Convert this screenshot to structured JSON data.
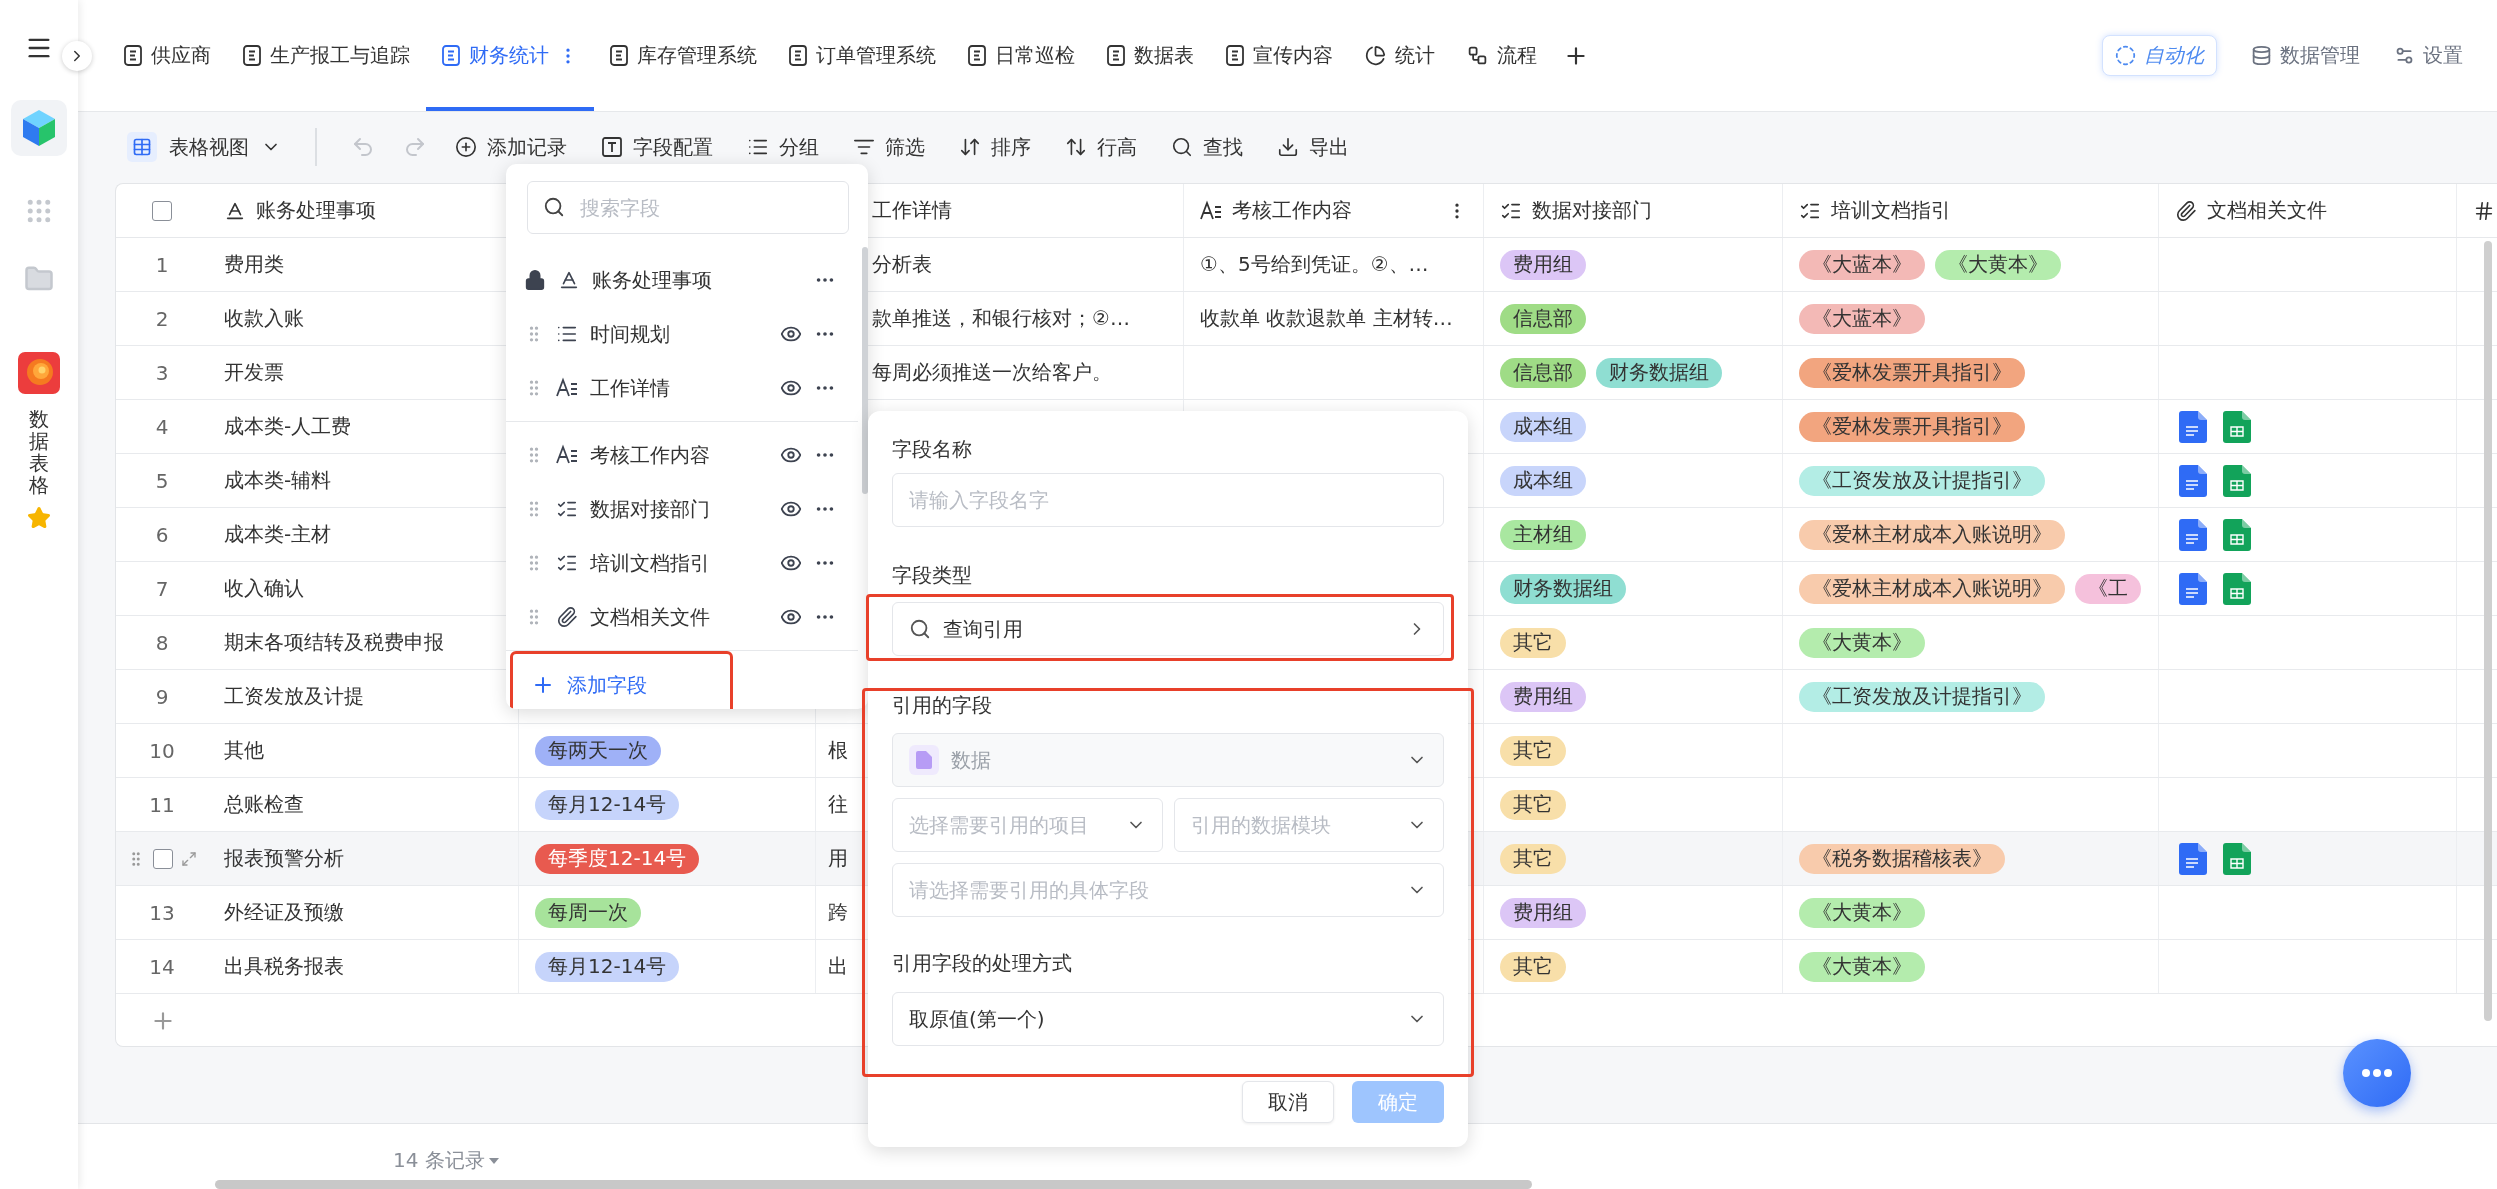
{
  "sidebar": {
    "app_name": "数据表格",
    "favorite": true
  },
  "tabs": [
    {
      "label": "供应商",
      "kind": "doc",
      "selected": false
    },
    {
      "label": "生产报工与追踪",
      "kind": "doc",
      "selected": false
    },
    {
      "label": "财务统计",
      "kind": "doc",
      "selected": true
    },
    {
      "label": "库存管理系统",
      "kind": "doc",
      "selected": false
    },
    {
      "label": "订单管理系统",
      "kind": "doc",
      "selected": false
    },
    {
      "label": "日常巡检",
      "kind": "doc",
      "selected": false
    },
    {
      "label": "数据表",
      "kind": "doc",
      "selected": false
    },
    {
      "label": "宣传内容",
      "kind": "doc",
      "selected": false
    },
    {
      "label": "统计",
      "kind": "chart",
      "selected": false
    },
    {
      "label": "流程",
      "kind": "flow",
      "selected": false
    }
  ],
  "top_actions": [
    {
      "label": "自动化",
      "kind": "automation"
    },
    {
      "label": "数据管理",
      "kind": "data"
    },
    {
      "label": "设置",
      "kind": "settings"
    }
  ],
  "toolbar": {
    "view": "表格视图",
    "history": [
      {
        "kind": "undo",
        "disabled": true
      },
      {
        "kind": "redo",
        "disabled": true
      }
    ],
    "actions": [
      {
        "label": "添加记录",
        "kind": "add"
      },
      {
        "label": "字段配置",
        "kind": "fields"
      },
      {
        "label": "分组",
        "kind": "group"
      },
      {
        "label": "筛选",
        "kind": "filter"
      },
      {
        "label": "排序",
        "kind": "sort"
      },
      {
        "label": "行高",
        "kind": "row_height"
      },
      {
        "label": "查找",
        "kind": "find"
      },
      {
        "label": "导出",
        "kind": "export"
      }
    ]
  },
  "table": {
    "all_checked": false,
    "columns": [
      {
        "label": "账务处理事项",
        "kind": "text"
      },
      {
        "label": "工作详情"
      },
      {
        "label": "考核工作内容",
        "kind": "long_text",
        "menu": true
      },
      {
        "label": "数据对接部门",
        "kind": "multi_select"
      },
      {
        "label": "培训文档指引",
        "kind": "multi_select"
      },
      {
        "label": "文档相关文件",
        "kind": "attachment"
      },
      {
        "kind": "number"
      }
    ],
    "rows": [
      {
        "number": "1",
        "item": "费用类",
        "detail": "分析表",
        "review": "①、5号给到凭证。②、…",
        "departments": [
          {
            "label": "费用组",
            "color": "#dcc6f6"
          }
        ],
        "guides": [
          {
            "label": "《大蓝本》",
            "color": "#f3b9b6"
          },
          {
            "label": "《大黄本》",
            "color": "#b4ecad"
          }
        ],
        "hovered": false,
        "checked": false
      },
      {
        "number": "2",
        "item": "收款入账",
        "detail": "款单推送，和银行核对；②…",
        "review": "收款单 收款退款单 主材转…",
        "departments": [
          {
            "label": "信息部",
            "color": "#9fdc86"
          }
        ],
        "guides": [
          {
            "label": "《大蓝本》",
            "color": "#f3b9b6"
          }
        ],
        "hovered": false,
        "checked": false
      },
      {
        "number": "3",
        "item": "开发票",
        "detail": "每周必须推送一次给客户。",
        "departments": [
          {
            "label": "信息部",
            "color": "#9fdc86"
          },
          {
            "label": "财务数据组",
            "color": "#8fded2"
          }
        ],
        "guides": [
          {
            "label": "《爱林发票开具指引》",
            "color": "#f2a57f"
          }
        ],
        "hovered": false,
        "checked": false
      },
      {
        "number": "4",
        "item": "成本类-人工费",
        "departments": [
          {
            "label": "成本组",
            "color": "#c8d5fb"
          }
        ],
        "guides": [
          {
            "label": "《爱林发票开具指引》",
            "color": "#f2a57f"
          }
        ],
        "files": [
          {
            "kind": "doc"
          },
          {
            "kind": "sheet"
          }
        ],
        "hovered": false,
        "checked": false
      },
      {
        "number": "5",
        "item": "成本类-辅料",
        "departments": [
          {
            "label": "成本组",
            "color": "#c8d5fb"
          }
        ],
        "guides": [
          {
            "label": "《工资发放及计提指引》",
            "color": "#b3ede5"
          }
        ],
        "files": [
          {
            "kind": "doc"
          },
          {
            "kind": "sheet"
          }
        ],
        "hovered": false,
        "checked": false
      },
      {
        "number": "6",
        "item": "成本类-主材",
        "departments": [
          {
            "label": "主材组",
            "color": "#a9e7a0"
          }
        ],
        "guides": [
          {
            "label": "《爱林主材成本入账说明》",
            "color": "#f8cbac"
          }
        ],
        "files": [
          {
            "kind": "doc"
          },
          {
            "kind": "sheet"
          }
        ],
        "hovered": false,
        "checked": false
      },
      {
        "number": "7",
        "item": "收入确认",
        "departments": [
          {
            "label": "财务数据组",
            "color": "#8fded2"
          }
        ],
        "guides": [
          {
            "label": "《爱林主材成本入账说明》",
            "color": "#f8cbac"
          },
          {
            "label": "《工",
            "color": "#f5c1dc"
          }
        ],
        "files": [
          {
            "kind": "doc"
          },
          {
            "kind": "sheet"
          }
        ],
        "hovered": false,
        "checked": false
      },
      {
        "number": "8",
        "item": "期末各项结转及税费申报",
        "departments": [
          {
            "label": "其它",
            "color": "#f8dfa9"
          }
        ],
        "guides": [
          {
            "label": "《大黄本》",
            "color": "#b4ecad"
          }
        ],
        "hovered": false,
        "checked": false
      },
      {
        "number": "9",
        "item": "工资发放及计提",
        "departments": [
          {
            "label": "费用组",
            "color": "#dcc6f6"
          }
        ],
        "guides": [
          {
            "label": "《工资发放及计提指引》",
            "color": "#b3ede5"
          }
        ],
        "hovered": false,
        "checked": false
      },
      {
        "number": "10",
        "item": "其他",
        "plan": {
          "label": "每两天一次",
          "color": "#9fb1f7"
        },
        "detail": "根",
        "departments": [
          {
            "label": "其它",
            "color": "#f8dfa9"
          }
        ],
        "hovered": false,
        "checked": false
      },
      {
        "number": "11",
        "item": "总账检查",
        "plan": {
          "label": "每月12-14号",
          "color": "#c6d4fb"
        },
        "detail": "往",
        "departments": [
          {
            "label": "其它",
            "color": "#f8dfa9"
          }
        ],
        "hovered": false,
        "checked": false
      },
      {
        "item": "报表预警分析",
        "plan": {
          "label": "每季度12-14号",
          "color": "#e85a4f"
        },
        "detail": "用",
        "departments": [
          {
            "label": "其它",
            "color": "#f8dfa9"
          }
        ],
        "guides": [
          {
            "label": "《税务数据稽核表》",
            "color": "#f8cbac"
          }
        ],
        "files": [
          {
            "kind": "doc"
          },
          {
            "kind": "sheet"
          }
        ],
        "hovered": true,
        "checked": false
      },
      {
        "number": "13",
        "item": "外经证及预缴",
        "plan": {
          "label": "每周一次",
          "color": "#a7e39b"
        },
        "detail": "跨",
        "departments": [
          {
            "label": "费用组",
            "color": "#dcc6f6"
          }
        ],
        "guides": [
          {
            "label": "《大黄本》",
            "color": "#b4ecad"
          }
        ],
        "hovered": false,
        "checked": false
      },
      {
        "number": "14",
        "item": "出具税务报表",
        "plan": {
          "label": "每月12-14号",
          "color": "#c6d4fb"
        },
        "detail": "出",
        "departments": [
          {
            "label": "其它",
            "color": "#f8dfa9"
          }
        ],
        "guides": [
          {
            "label": "《大黄本》",
            "color": "#b4ecad"
          }
        ],
        "hovered": false,
        "checked": false
      }
    ]
  },
  "footer": {
    "record_count": "14 条记录"
  },
  "field_panel": {
    "search_placeholder": "搜索字段",
    "groups": [
      {
        "fields": [
          {
            "label": "账务处理事项",
            "kind": "text",
            "locked": true
          },
          {
            "label": "时间规划",
            "kind": "list",
            "locked": false,
            "visible": true
          },
          {
            "label": "工作详情",
            "kind": "long_text",
            "locked": false,
            "visible": true
          }
        ]
      },
      {
        "fields": [
          {
            "label": "考核工作内容",
            "kind": "long_text",
            "locked": false,
            "visible": true
          },
          {
            "label": "数据对接部门",
            "kind": "multi_select",
            "locked": false,
            "visible": true
          },
          {
            "label": "培训文档指引",
            "kind": "multi_select",
            "locked": false,
            "visible": true
          },
          {
            "label": "文档相关文件",
            "kind": "attachment",
            "locked": false,
            "visible": true
          }
        ]
      }
    ],
    "add_field": {
      "label": "添加字段",
      "highlighted": true
    }
  },
  "field_editor": {
    "name_label": "字段名称",
    "name_placeholder": "请输入字段名字",
    "type_label": "字段类型",
    "type": {
      "value": "查询引用",
      "highlighted": true
    },
    "reference": {
      "highlighted": true,
      "label": "引用的字段",
      "source": {
        "value": "数据",
        "disabled": true
      },
      "project_placeholder": "选择需要引用的项目",
      "module_placeholder": "引用的数据模块",
      "field_placeholder": "请选择需要引用的具体字段",
      "mode_label": "引用字段的处理方式",
      "mode_value": "取原值(第一个)"
    },
    "cancel": "取消",
    "confirm": {
      "label": "确定",
      "disabled": true
    }
  }
}
